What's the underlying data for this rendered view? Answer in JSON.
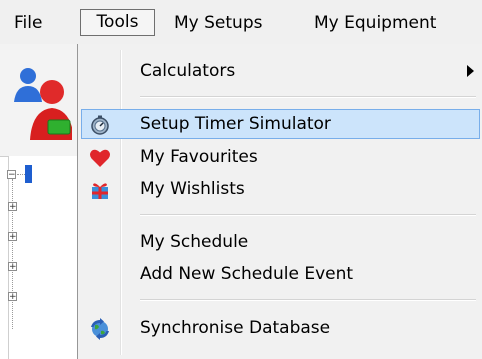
{
  "menubar": {
    "items": [
      {
        "label": "File"
      },
      {
        "label": "Tools"
      },
      {
        "label": "My Setups"
      },
      {
        "label": "My Equipment"
      }
    ]
  },
  "tools_menu": {
    "items": [
      {
        "label": "Calculators",
        "icon": "none",
        "has_submenu": true
      },
      {
        "label": "Setup Timer Simulator",
        "icon": "stopwatch-icon",
        "highlighted": true
      },
      {
        "label": "My Favourites",
        "icon": "heart-icon"
      },
      {
        "label": "My Wishlists",
        "icon": "gift-icon"
      },
      {
        "label": "My Schedule",
        "icon": "none"
      },
      {
        "label": "Add New Schedule Event",
        "icon": "none"
      },
      {
        "label": "Synchronise Database",
        "icon": "sync-globe-icon"
      }
    ]
  },
  "colors": {
    "menu_background": "#f1f1f1",
    "highlight_fill": "#cce4fb",
    "highlight_border": "#78aeea",
    "heart": "#e0262c"
  }
}
